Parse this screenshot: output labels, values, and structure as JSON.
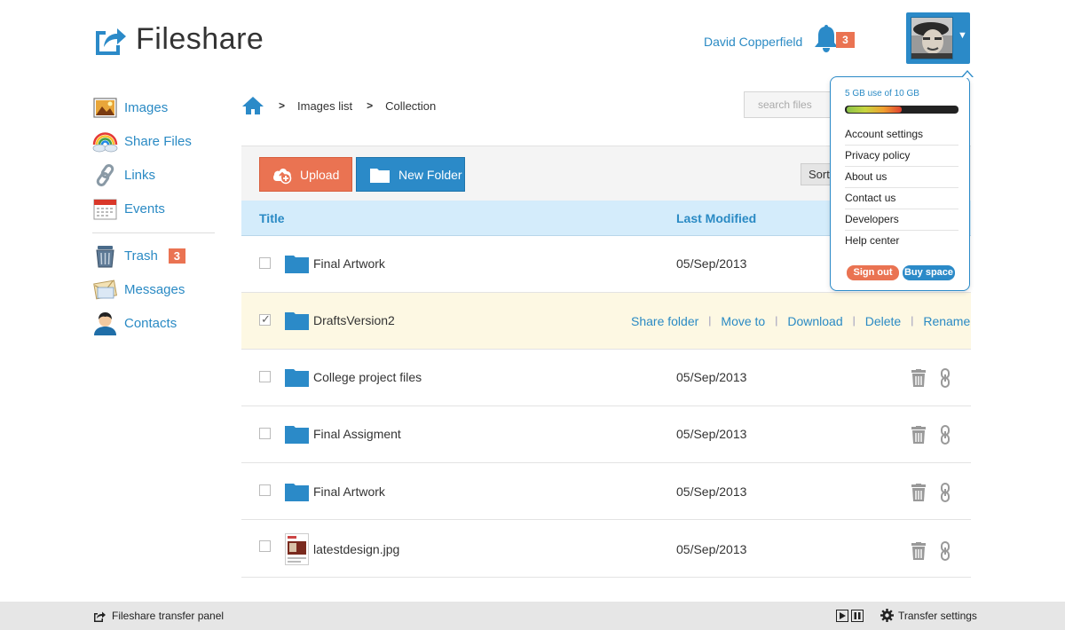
{
  "app": {
    "name": "Fileshare"
  },
  "header": {
    "user_name": "David Copperfield",
    "notification_count": "3"
  },
  "sidebar": {
    "items": [
      {
        "label": "Images",
        "icon": "images-icon"
      },
      {
        "label": "Share Files",
        "icon": "rainbow-cloud-icon"
      },
      {
        "label": "Links",
        "icon": "chain-link-icon"
      },
      {
        "label": "Events",
        "icon": "calendar-icon"
      }
    ],
    "items2": [
      {
        "label": "Trash",
        "icon": "trash-bin-icon",
        "badge": "3"
      },
      {
        "label": "Messages",
        "icon": "envelope-icon"
      },
      {
        "label": "Contacts",
        "icon": "person-icon"
      }
    ]
  },
  "breadcrumb": {
    "items": [
      "Images list",
      "Collection"
    ]
  },
  "search": {
    "placeholder": "search files"
  },
  "toolbar": {
    "upload_label": "Upload",
    "new_folder_label": "New Folder",
    "sort_label": "Sort"
  },
  "table": {
    "columns": [
      "Title",
      "Last Modified"
    ],
    "rows": [
      {
        "name": "Final Artwork",
        "date": "05/Sep/2013",
        "type": "folder",
        "checked": false
      },
      {
        "name": "DraftsVersion2",
        "date": "",
        "type": "folder",
        "checked": true,
        "actions": [
          "Share folder",
          "Move to",
          "Download",
          "Delete",
          "Rename"
        ]
      },
      {
        "name": "College project files",
        "date": "05/Sep/2013",
        "type": "folder",
        "checked": false
      },
      {
        "name": "Final Assigment",
        "date": "05/Sep/2013",
        "type": "folder",
        "checked": false
      },
      {
        "name": "Final Artwork",
        "date": "05/Sep/2013",
        "type": "folder",
        "checked": false
      },
      {
        "name": "latestdesign.jpg",
        "date": "05/Sep/2013",
        "type": "image",
        "checked": false
      }
    ]
  },
  "account_menu": {
    "storage_text": "5 GB use of 10 GB",
    "storage_used_fraction": 0.5,
    "items": [
      "Account settings",
      "Privacy policy",
      "About us",
      "Contact us",
      "Developers",
      "Help center"
    ],
    "sign_out_label": "Sign out",
    "buy_space_label": "Buy space"
  },
  "footer": {
    "transfer_panel_label": "Fileshare transfer panel",
    "transfer_settings_label": "Transfer settings"
  },
  "colors": {
    "accent_blue": "#2b8ac8",
    "accent_orange": "#ea7352",
    "header_row_bg": "#d4ecfb",
    "selected_row_bg": "#fdf8e3"
  }
}
